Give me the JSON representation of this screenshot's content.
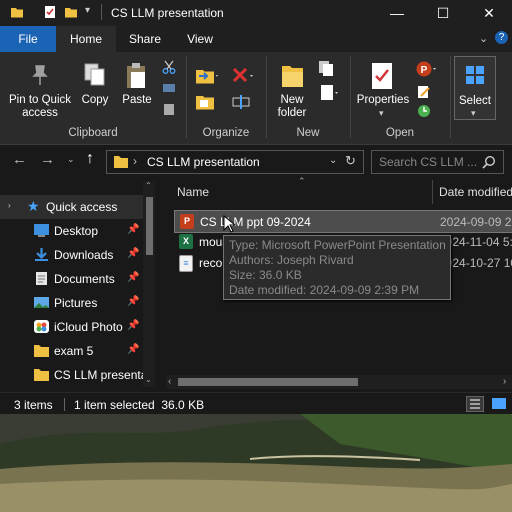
{
  "window": {
    "title": "CS LLM presentation",
    "controls": {
      "minimize": "—",
      "maximize": "☐",
      "close": "✕"
    }
  },
  "ribbon_tabs": [
    "File",
    "Home",
    "Share",
    "View"
  ],
  "ribbon": {
    "clipboard": {
      "pin_label_1": "Pin to Quick",
      "pin_label_2": "access",
      "copy_label": "Copy",
      "paste_label": "Paste",
      "group_label": "Clipboard"
    },
    "organize": {
      "group_label": "Organize"
    },
    "new": {
      "folder_label_1": "New",
      "folder_label_2": "folder",
      "group_label": "New"
    },
    "open": {
      "properties_label": "Properties",
      "group_label": "Open"
    },
    "select": {
      "select_label": "Select"
    }
  },
  "address": {
    "path": "CS LLM presentation",
    "separator": "›",
    "search_placeholder": "Search CS LLM ..."
  },
  "nav": {
    "items": [
      {
        "label": "Quick access",
        "icon": "star-icon",
        "pinned": false
      },
      {
        "label": "Desktop",
        "icon": "desktop-icon",
        "pinned": true
      },
      {
        "label": "Downloads",
        "icon": "download-icon",
        "pinned": true
      },
      {
        "label": "Documents",
        "icon": "documents-icon",
        "pinned": true
      },
      {
        "label": "Pictures",
        "icon": "pictures-icon",
        "pinned": true
      },
      {
        "label": "iCloud Photo",
        "icon": "icloud-icon",
        "pinned": true
      },
      {
        "label": "exam 5",
        "icon": "folder-icon",
        "pinned": true
      },
      {
        "label": "CS LLM presenta",
        "icon": "folder-icon",
        "pinned": false
      }
    ]
  },
  "columns": {
    "name": "Name",
    "date": "Date modified"
  },
  "files": [
    {
      "name": "CS LLM ppt 09-2024",
      "date": "2024-09-09 2:3",
      "type": "powerpoint",
      "selected": true
    },
    {
      "name": "mouse_actions",
      "date": "2024-11-04 5:0",
      "type": "excel",
      "selected": false
    },
    {
      "name": "record",
      "date": "2024-10-27 10",
      "type": "text",
      "selected": false
    }
  ],
  "tooltip": {
    "type": "Type: Microsoft PowerPoint Presentation",
    "authors": "Authors: Joseph Rivard",
    "size": "Size: 36.0 KB",
    "modified": "Date modified: 2024-09-09 2:39 PM"
  },
  "status": {
    "items": "3 items",
    "selected": "1 item selected  36.0 KB"
  },
  "colors": {
    "accent": "#1b63b4",
    "selection": "#4d4d4d",
    "folder": "#f0c043"
  }
}
